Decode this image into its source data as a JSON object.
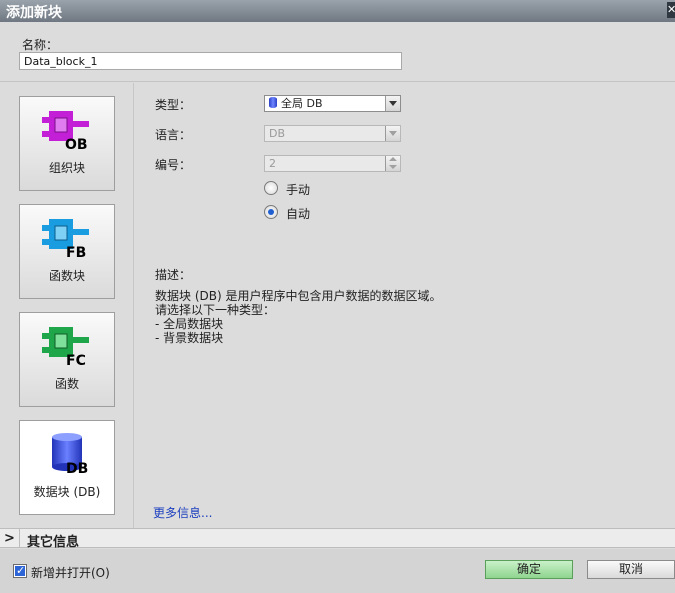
{
  "window": {
    "title": "添加新块"
  },
  "name_field": {
    "label": "名称：",
    "value": "Data_block_1"
  },
  "block_types": [
    {
      "label": "组织块",
      "badge": "OB",
      "color": "#c21fd6"
    },
    {
      "label": "函数块",
      "badge": "FB",
      "color": "#1a9de0"
    },
    {
      "label": "函数",
      "badge": "FC",
      "color": "#1fa64a"
    },
    {
      "label": "数据块 (DB)",
      "badge": "DB",
      "color": "#3b4de0",
      "selected": true
    }
  ],
  "properties": {
    "type_label": "类型：",
    "type_value": "全局 DB",
    "language_label": "语言：",
    "language_value": "DB",
    "number_label": "编号：",
    "number_value": "2",
    "manual_label": "手动",
    "auto_label": "自动",
    "numbering_mode": "auto"
  },
  "description": {
    "title": "描述：",
    "text": "数据块 (DB) 是用户程序中包含用户数据的数据区域。\n请选择以下一种类型：\n- 全局数据块\n- 背景数据块"
  },
  "more_info_link": "更多信息...",
  "other_info": {
    "label": "其它信息"
  },
  "footer": {
    "add_and_open_label": "新增并打开(O)",
    "add_and_open_checked": true,
    "ok_label": "确定",
    "cancel_label": "取消"
  }
}
